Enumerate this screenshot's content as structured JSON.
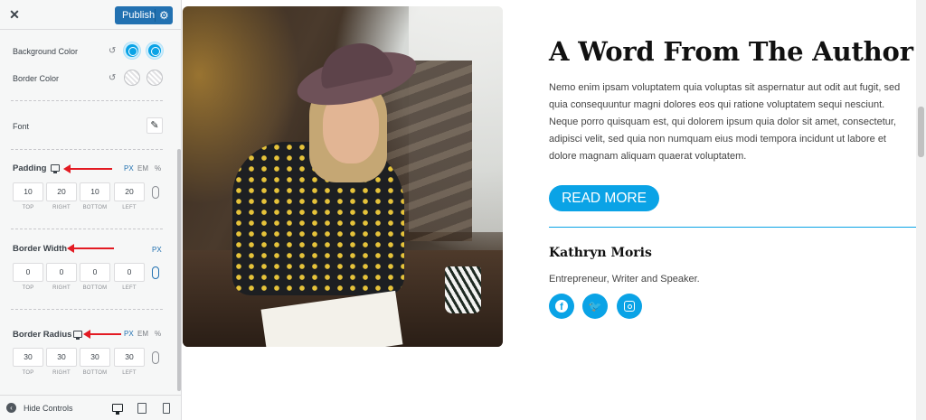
{
  "sidebar": {
    "close_icon": "close-icon",
    "publish_label": "Publish",
    "background_color_label": "Background Color",
    "border_color_label": "Border Color",
    "font_label": "Font",
    "padding": {
      "label": "Padding",
      "units": [
        "PX",
        "EM",
        "%"
      ],
      "active_unit": "PX",
      "values": [
        "10",
        "20",
        "10",
        "20"
      ],
      "captions": [
        "TOP",
        "RIGHT",
        "BOTTOM",
        "LEFT"
      ]
    },
    "border_width": {
      "label": "Border Width",
      "units": [
        "PX"
      ],
      "active_unit": "PX",
      "values": [
        "0",
        "0",
        "0",
        "0"
      ],
      "captions": [
        "TOP",
        "RIGHT",
        "BOTTOM",
        "LEFT"
      ]
    },
    "border_radius": {
      "label": "Border Radius",
      "units": [
        "PX",
        "EM",
        "%"
      ],
      "active_unit": "PX",
      "values": [
        "30",
        "30",
        "30",
        "30"
      ],
      "captions": [
        "TOP",
        "RIGHT",
        "BOTTOM",
        "LEFT"
      ]
    },
    "hide_controls_label": "Hide Controls"
  },
  "preview": {
    "heading": "A Word From The Author",
    "body": "Nemo enim ipsam voluptatem quia voluptas sit aspernatur aut odit aut fugit, sed quia consequuntur magni dolores eos qui ratione voluptatem sequi nesciunt. Neque porro quisquam est, qui dolorem ipsum quia dolor sit amet, consectetur, adipisci velit, sed quia non numquam eius modi tempora incidunt ut labore et dolore magnam aliquam quaerat voluptatem.",
    "button_label": "READ MORE",
    "author_name": "Kathryn Moris",
    "author_role": "Entrepreneur, Writer and Speaker.",
    "social_icons": [
      "facebook-icon",
      "twitter-icon",
      "instagram-icon"
    ]
  },
  "colors": {
    "accent": "#0aa3e6",
    "publish": "#2271b1",
    "annotation_arrow": "#e31b23"
  }
}
